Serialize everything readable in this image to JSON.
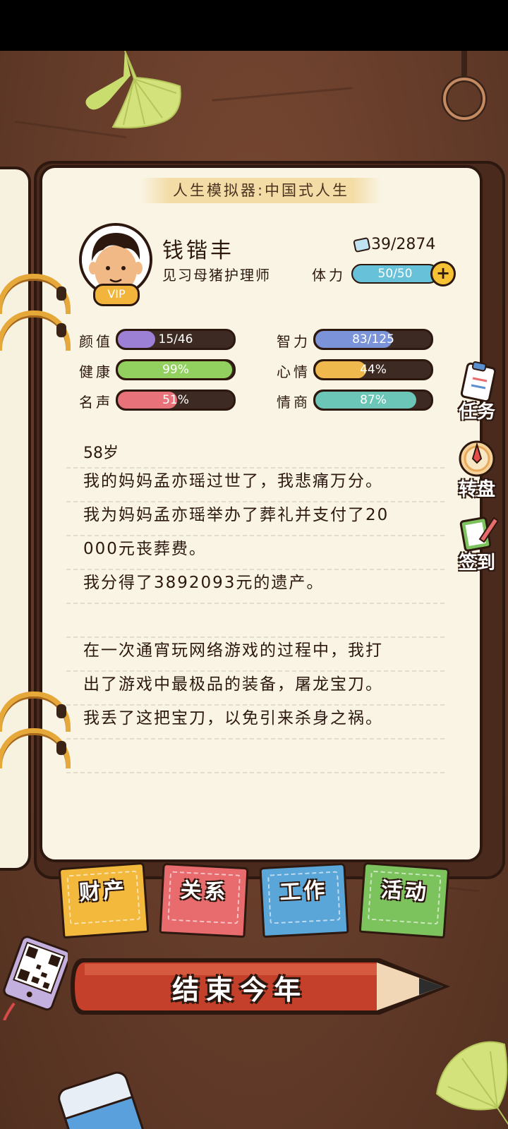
{
  "game": {
    "title": "人生模拟器:中国式人生"
  },
  "character": {
    "name": "钱锴丰",
    "job": "见习母猪护理师",
    "vip_badge": "VIP",
    "tickets": "39/2874",
    "stamina_label": "体力",
    "stamina_value": "50/50",
    "stamina_fraction": 1.0
  },
  "stats": [
    {
      "label": "颜值",
      "value": "15/46",
      "fraction": 0.326,
      "color": "#9b80d6"
    },
    {
      "label": "智力",
      "value": "83/125",
      "fraction": 0.664,
      "color": "#7b94d9"
    },
    {
      "label": "健康",
      "value": "99%",
      "fraction": 0.99,
      "color": "#92d160"
    },
    {
      "label": "心情",
      "value": "44%",
      "fraction": 0.44,
      "color": "#f0b94e"
    },
    {
      "label": "名声",
      "value": "51%",
      "fraction": 0.51,
      "color": "#e8727a"
    },
    {
      "label": "情商",
      "value": "87%",
      "fraction": 0.87,
      "color": "#6cc6b8"
    }
  ],
  "log": {
    "age": "58岁",
    "lines": [
      "我的妈妈孟亦瑶过世了，我悲痛万分。",
      "我为妈妈孟亦瑶举办了葬礼并支付了20",
      "000元丧葬费。",
      "我分得了3892093元的遗产。",
      "",
      "在一次通宵玩网络游戏的过程中，我打",
      "出了游戏中最极品的装备，屠龙宝刀。",
      "我丢了这把宝刀，以免引来杀身之祸。"
    ]
  },
  "side_buttons": [
    "任务",
    "转盘",
    "签到"
  ],
  "tabs": [
    {
      "label": "财产",
      "color": "#f2b93c"
    },
    {
      "label": "关系",
      "color": "#e86b6e"
    },
    {
      "label": "工作",
      "color": "#5ba6d9"
    },
    {
      "label": "活动",
      "color": "#7cc35e"
    }
  ],
  "end_year_button": "结束今年"
}
